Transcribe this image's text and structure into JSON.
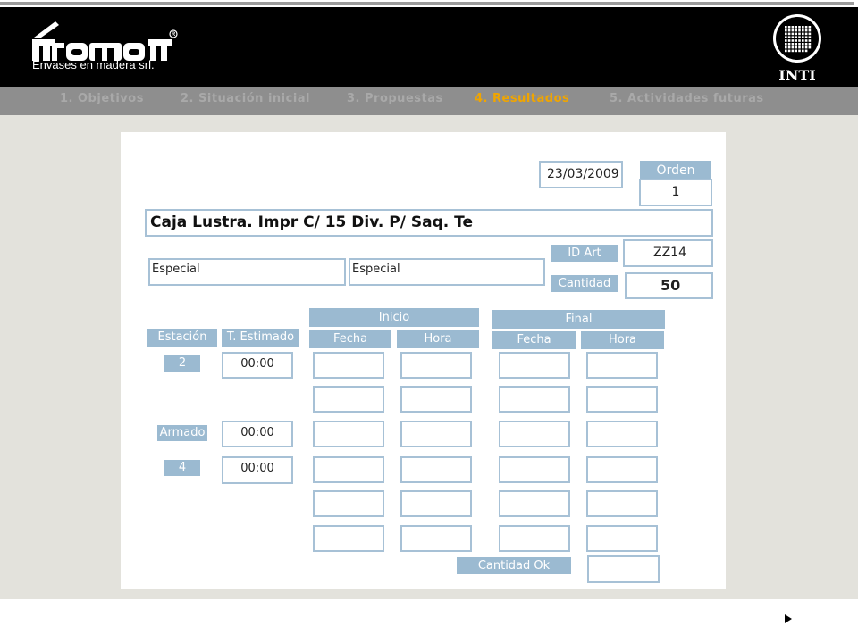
{
  "brand": {
    "tagline": "Envases en madera srl.",
    "partner": "INTI",
    "registered": "R"
  },
  "nav": [
    {
      "label": "1. Objetivos"
    },
    {
      "label": "2. Situación inicial"
    },
    {
      "label": "3. Propuestas"
    },
    {
      "label": "4. Resultados",
      "active": true
    },
    {
      "label": "5. Actividades futuras"
    }
  ],
  "form": {
    "date": "23/03/2009",
    "orden_label": "Orden",
    "orden_value": "1",
    "title": "Caja Lustra. Impr C/ 15 Div. P/ Saq. Te",
    "tipo1": "Especial",
    "tipo2": "Especial",
    "id_art_label": "ID Art",
    "id_art_value": "ZZ14",
    "cantidad_label": "Cantidad",
    "cantidad_value": "50",
    "inicio_label": "Inicio",
    "final_label": "Final",
    "estacion_label": "Estación",
    "t_estimado_label": "T. Estimado",
    "fecha_label": "Fecha",
    "hora_label": "Hora",
    "stations": [
      {
        "name": "2",
        "time": "00:00"
      },
      {
        "name": "Armado",
        "time": "00:00"
      },
      {
        "name": "4",
        "time": "00:00"
      }
    ],
    "cantidad_ok_label": "Cantidad Ok"
  },
  "colors": {
    "label_blue": "#9bbad1",
    "box_border": "#a7c1d6",
    "nav_active": "#f0a500",
    "content_bg": "#e3e2dc"
  }
}
